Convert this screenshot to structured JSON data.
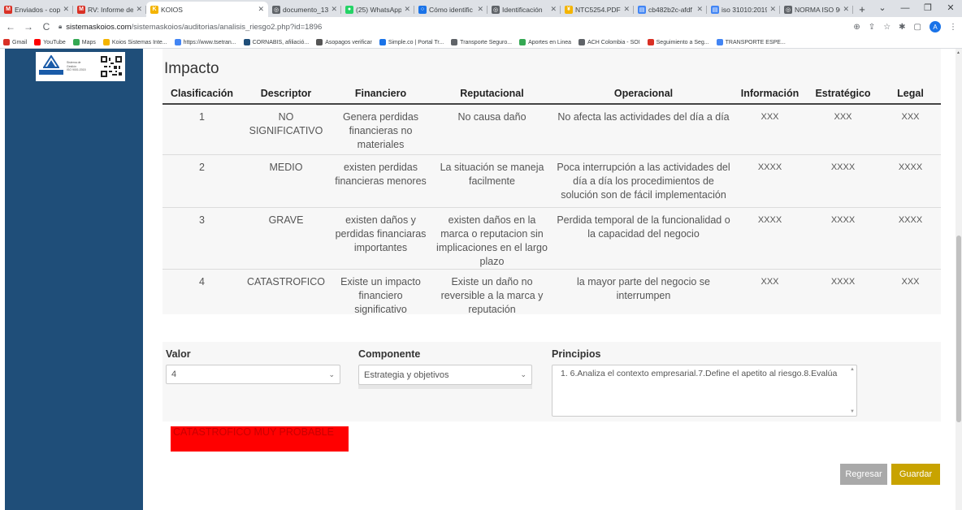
{
  "browser": {
    "tabs": [
      {
        "label": "Enviados - copp",
        "icon": "gmail-icon",
        "color": "#d93025",
        "glyph": "M"
      },
      {
        "label": "RV: Informe de",
        "icon": "gmail-icon",
        "color": "#d93025",
        "glyph": "M"
      },
      {
        "label": "KOIOS",
        "icon": "koios-icon",
        "color": "#f4b400",
        "glyph": "K",
        "active": true
      },
      {
        "label": "documento_13",
        "icon": "globe-icon",
        "color": "#5f6368",
        "glyph": "◎"
      },
      {
        "label": "(25) WhatsApp",
        "icon": "whatsapp-icon",
        "color": "#25d366",
        "glyph": "●"
      },
      {
        "label": "Cómo identific",
        "icon": "search-icon",
        "color": "#1a73e8",
        "glyph": "○"
      },
      {
        "label": "Identificación",
        "icon": "globe-icon",
        "color": "#5f6368",
        "glyph": "◎"
      },
      {
        "label": "NTC5254.PDF",
        "icon": "pdf-icon",
        "color": "#f4b400",
        "glyph": "¥"
      },
      {
        "label": "cb482b2c-afdf",
        "icon": "doc-icon",
        "color": "#4285f4",
        "glyph": "▤"
      },
      {
        "label": "iso 31010:2019",
        "icon": "doc-icon",
        "color": "#4285f4",
        "glyph": "▤"
      },
      {
        "label": "NORMA ISO 90",
        "icon": "globe-icon",
        "color": "#5f6368",
        "glyph": "◎"
      }
    ],
    "new_tab": "+",
    "url_host": "sistemaskoios.com",
    "url_path": "/sistemaskoios/auditorias/analisis_riesgo2.php?id=1896",
    "profile_initial": "A",
    "bookmarks": [
      {
        "label": "Gmail",
        "color": "#d93025"
      },
      {
        "label": "YouTube",
        "color": "#ff0000"
      },
      {
        "label": "Maps",
        "color": "#34a853"
      },
      {
        "label": "Koios Sistemas Inte...",
        "color": "#f4b400"
      },
      {
        "label": "https://www.tsetran...",
        "color": "#4285f4"
      },
      {
        "label": "CORNABIS, afiliació...",
        "color": "#1f4e79"
      },
      {
        "label": "Asopagos verificar",
        "color": "#555555"
      },
      {
        "label": "Simple.co | Portal Tr...",
        "color": "#1a73e8"
      },
      {
        "label": "Transporte Seguro...",
        "color": "#5f6368"
      },
      {
        "label": "Aportes en Linea",
        "color": "#34a853"
      },
      {
        "label": "ACH Colombia - SOI",
        "color": "#5f6368"
      },
      {
        "label": "Seguimiento a Seg...",
        "color": "#d93025"
      },
      {
        "label": "TRANSPORTE ESPE...",
        "color": "#4285f4"
      }
    ]
  },
  "sidebar": {
    "logo_lines": [
      "Sistema de",
      "Gestión",
      "ISO 9001:2015"
    ],
    "logo_brand": "TÜVRheinland",
    "logo_cert": "CERTIFICADO"
  },
  "impact": {
    "title": "Impacto",
    "headers": [
      "Clasificación",
      "Descriptor",
      "Financiero",
      "Reputacional",
      "Operacional",
      "Información",
      "Estratégico",
      "Legal"
    ],
    "rows": [
      [
        "1",
        "NO SIGNIFICATIVO",
        "Genera perdidas financieras no materiales",
        "No causa daño",
        "No afecta las actividades del día a día",
        "XXX",
        "XXX",
        "XXX"
      ],
      [
        "2",
        "MEDIO",
        "existen perdidas financieras menores",
        "La situación se maneja facilmente",
        "Poca interrupción a las actividades del día a día los procedimientos de solución son de fácil implementación",
        "XXXX",
        "XXXX",
        "XXXX"
      ],
      [
        "3",
        "GRAVE",
        "existen daños y perdidas financiaras importantes",
        "existen daños en la marca o reputacion sin implicaciones en el largo plazo",
        "Perdida temporal de la funcionalidad o la capacidad del negocio",
        "XXXX",
        "XXXX",
        "XXXX"
      ],
      [
        "4",
        "CATASTROFICO",
        "Existe un impacto financiero significativo",
        "Existe un daño no reversible a la marca y reputación",
        "la mayor parte del negocio se interrumpen",
        "XXX",
        "XXXX",
        "XXX"
      ]
    ]
  },
  "form": {
    "valor_label": "Valor",
    "valor_value": "4",
    "componente_label": "Componente",
    "componente_value": "Estrategia y objetivos",
    "principios_label": "Principios",
    "principios_value": "1. 6.Analiza el contexto empresarial.7.Define el apetito al riesgo.8.Evalúa"
  },
  "result": {
    "text": "CATASTROFICO MUY PROBABLE",
    "color": "#ff0000"
  },
  "actions": {
    "back_label": "Regresar",
    "save_label": "Guardar"
  },
  "colors": {
    "sidebar": "#1f4e79",
    "save": "#c8a300",
    "back": "#a9a9a9"
  }
}
